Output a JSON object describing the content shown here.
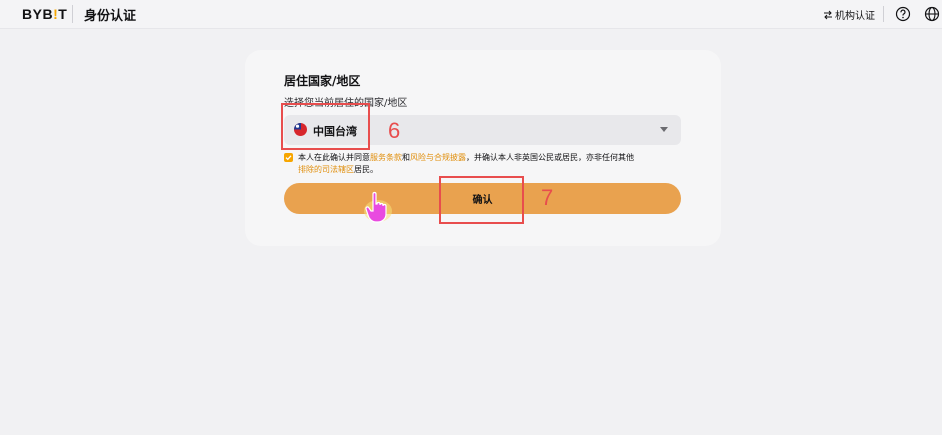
{
  "header": {
    "logo_left": "BYB",
    "logo_mid": "!",
    "logo_right": "T",
    "title": "身份认证",
    "org_link_icon": "swap-arrows-icon",
    "org_link": "机构认证",
    "help_icon": "help-circle-icon",
    "language_icon": "globe-icon"
  },
  "form": {
    "section_title": "居住国家/地区",
    "section_subtitle": "选择您当前居住的国家/地区",
    "country_select": {
      "flag_icon": "taiwan-flag-icon",
      "value": "中国台湾"
    },
    "agreement": {
      "checked": true,
      "text_1": "本人在此确认并同意",
      "link_terms": "服务条款",
      "text_2": "和",
      "link_risk": "风险与合规披露",
      "text_3": "，并确认本人非英国公民或居民，亦非任何其他",
      "link_jurisdiction": "排除的司法辖区",
      "text_4": "居民。"
    },
    "confirm_label": "确认"
  },
  "annotations": {
    "step_6": "6",
    "step_7": "7"
  },
  "colors": {
    "accent": "#f7a600",
    "button": "#e9a24f",
    "link": "#e08e0b",
    "annotation": "#e84d4d"
  }
}
